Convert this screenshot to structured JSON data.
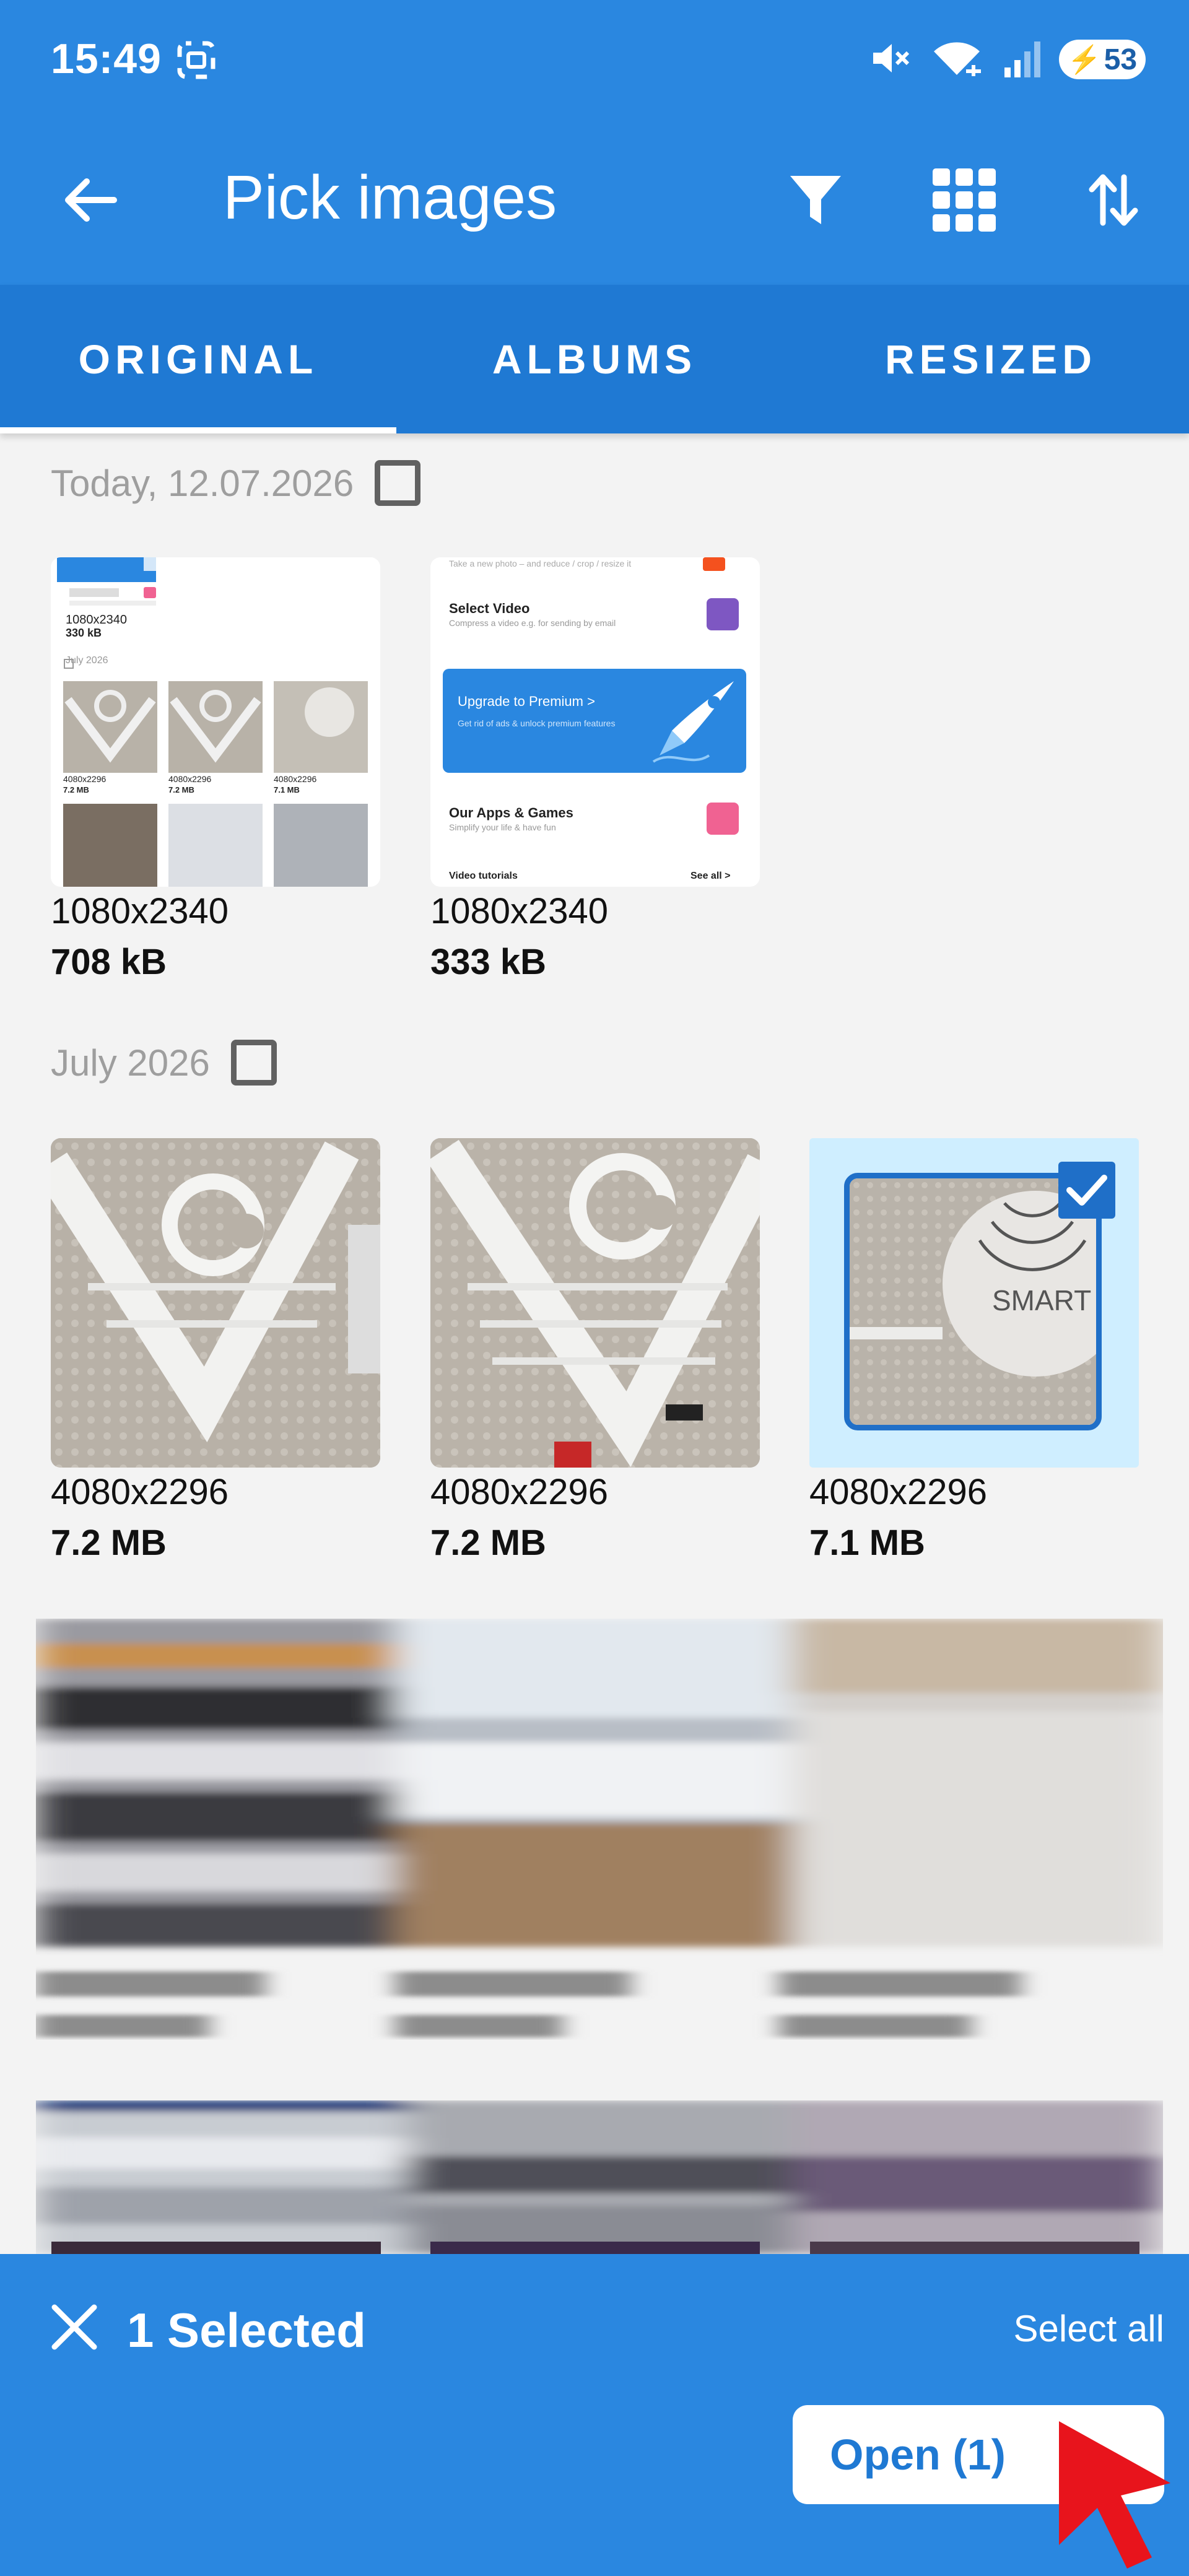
{
  "status_bar": {
    "time": "15:49",
    "battery": "53"
  },
  "app_bar": {
    "title": "Pick images"
  },
  "tabs": [
    {
      "label": "ORIGINAL",
      "selected": true
    },
    {
      "label": "ALBUMS",
      "selected": false
    },
    {
      "label": "RESIZED",
      "selected": false
    }
  ],
  "sections": [
    {
      "header": "Today, 12.07.2026",
      "items": [
        {
          "resolution": "1080x2340",
          "size": "708 kB",
          "selected": false
        },
        {
          "resolution": "1080x2340",
          "size": "333 kB",
          "selected": false
        }
      ]
    },
    {
      "header": "July 2026",
      "items": [
        {
          "resolution": "4080x2296",
          "size": "7.2 MB",
          "selected": false
        },
        {
          "resolution": "4080x2296",
          "size": "7.2 MB",
          "selected": false
        },
        {
          "resolution": "4080x2296",
          "size": "7.1 MB",
          "selected": true
        }
      ]
    }
  ],
  "thumb_1_text": {
    "res": "1080x2340",
    "size": "330 kB",
    "date": "July 2026",
    "grid": [
      "4080x2296",
      "4080x2296",
      "4080x2296"
    ],
    "grid_sizes": [
      "7.2 MB",
      "7.2 MB",
      "7.1 MB"
    ]
  },
  "thumb_2_text": {
    "top": "Take a new photo – and reduce / crop / resize it",
    "select_video": "Select Video",
    "select_video_sub": "Compress a video e.g. for sending by email",
    "premium": "Upgrade to Premium >",
    "premium_sub": "Get rid of ads & unlock premium features",
    "apps": "Our Apps & Games",
    "apps_sub": "Simplify your life & have fun",
    "tutorials": "Video tutorials",
    "see_all": "See all >"
  },
  "thumb_5_text": {
    "brand": "SMART"
  },
  "selection_bar": {
    "count_label": "1 Selected",
    "select_all": "Select all",
    "open_button": "Open (1)"
  },
  "colors": {
    "primary": "#2a87e0",
    "tab_bar": "#1f79d3",
    "selected_tint": "#cfeeff",
    "selected_border": "#1f6fc8"
  }
}
